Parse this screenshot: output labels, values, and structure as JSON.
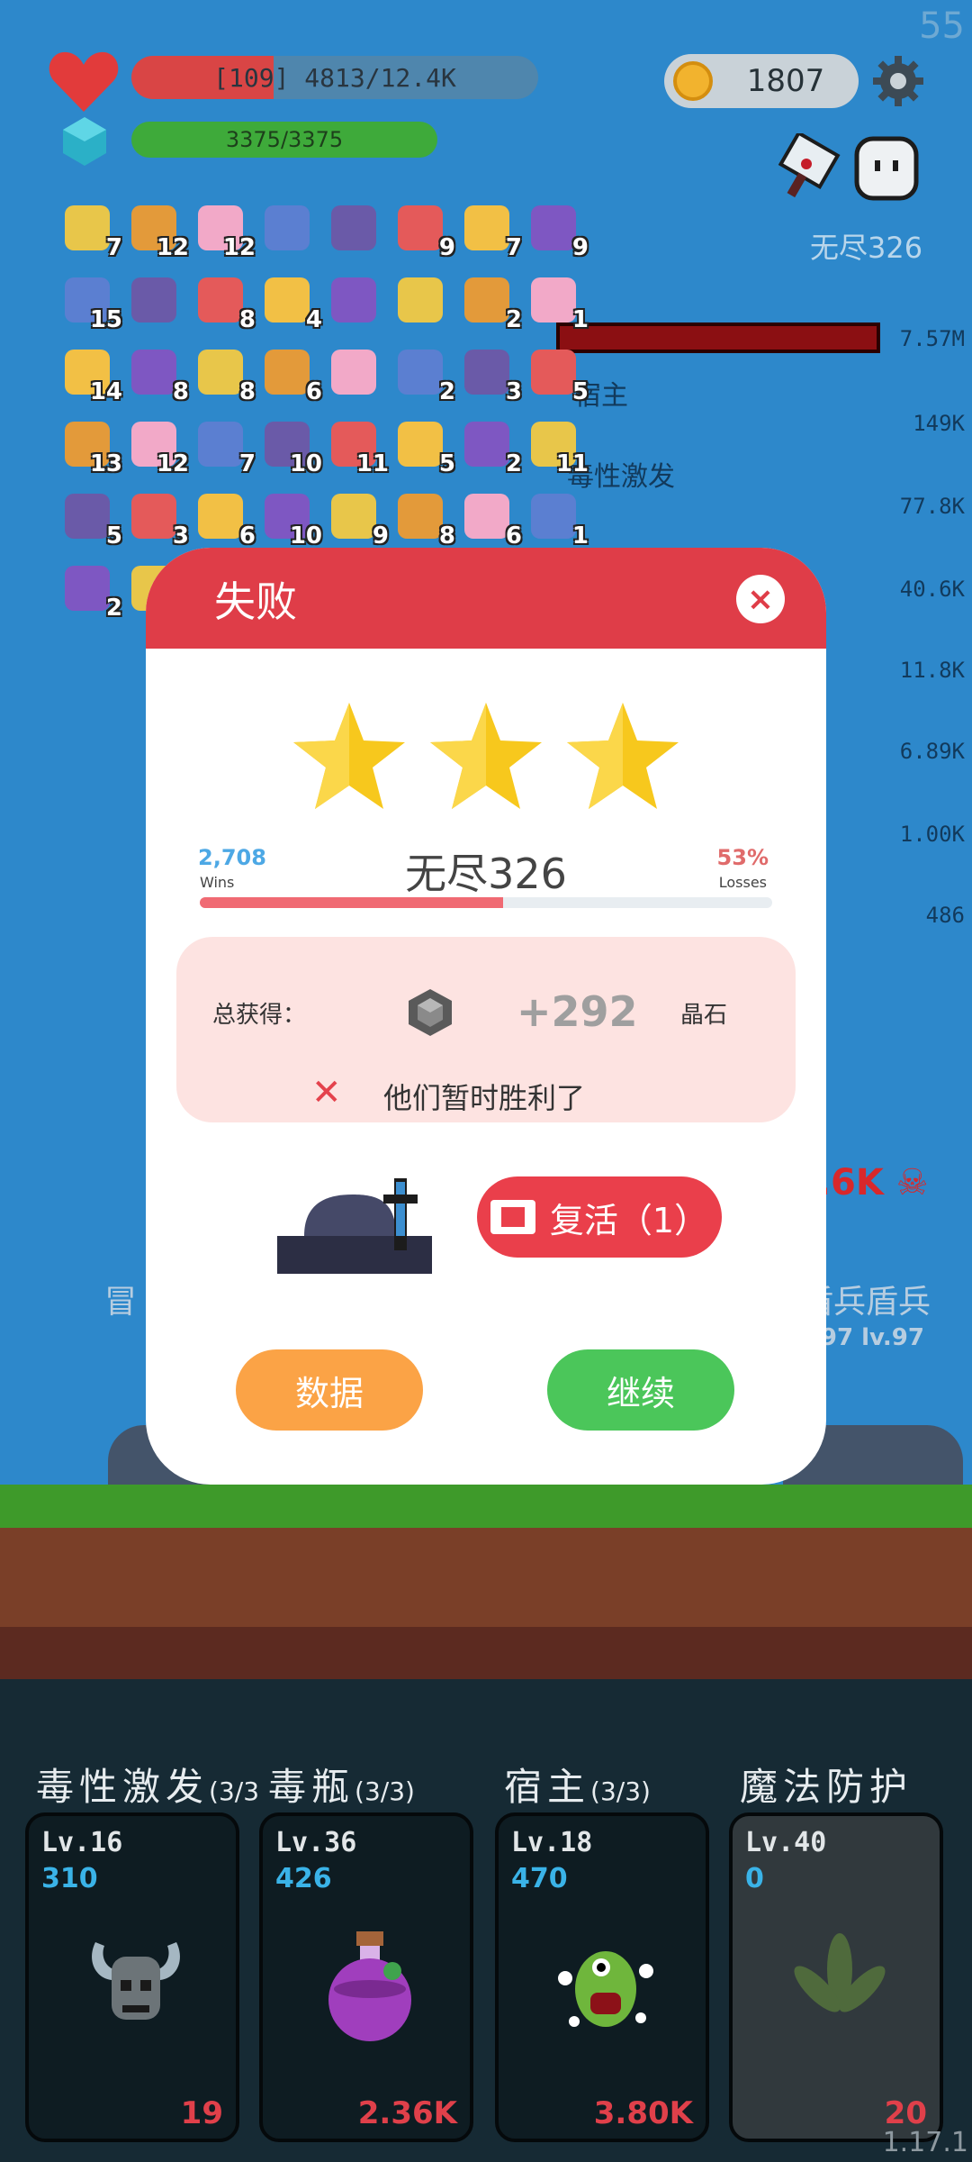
{
  "hud": {
    "fps": "55",
    "hp_text": "[109] 4813/12.4K",
    "mp_text": "3375/3375",
    "coins": "1807",
    "stage_label": "无尽326",
    "right_values": [
      "7.57M",
      "149K",
      "77.8K",
      "40.6K",
      "11.8K",
      "6.89K",
      "1.00K",
      "486"
    ],
    "skill_names_bg": [
      "宿主",
      "毒性激发"
    ],
    "skull_damage": "1.6K",
    "bg_name_left": "冒",
    "bg_name_right": "盾兵盾兵",
    "bg_level_right": ".97 lv.97"
  },
  "inventory": {
    "rows": [
      [
        "7",
        "12",
        "12",
        "",
        "",
        "9",
        "7",
        "9"
      ],
      [
        "15",
        "",
        "8",
        "4",
        "",
        "",
        "2",
        "1"
      ],
      [
        "14",
        "8",
        "8",
        "6",
        "",
        "2",
        "3",
        "5"
      ],
      [
        "13",
        "12",
        "7",
        "10",
        "11",
        "5",
        "2",
        "11"
      ],
      [
        "5",
        "3",
        "6",
        "10",
        "9",
        "8",
        "6",
        "1"
      ],
      [
        "2",
        "",
        "",
        "",
        "",
        "",
        "",
        ""
      ]
    ]
  },
  "modal": {
    "title": "失败",
    "close": "×",
    "stars": 3,
    "wins_num": "2,708",
    "wins_label": "Wins",
    "loss_num": "53%",
    "loss_label": "Losses",
    "level_name": "无尽326",
    "progress": 0.53,
    "reward_label": "总获得：",
    "reward_amount": "+292",
    "reward_unit": "晶石",
    "defeat_msg": "他们暂时胜利了",
    "revive_label": "复活（1）",
    "data_btn": "数据",
    "continue_btn": "继续"
  },
  "skills": [
    {
      "title": "毒性激发",
      "count": "(3/3",
      "level": "Lv.16",
      "points": "310",
      "value": "19"
    },
    {
      "title": "毒瓶",
      "count": "(3/3)",
      "level": "Lv.36",
      "points": "426",
      "value": "2.36K"
    },
    {
      "title": "宿主",
      "count": "(3/3)",
      "level": "Lv.18",
      "points": "470",
      "value": "3.80K"
    },
    {
      "title": "魔法防护",
      "count": "",
      "level": "Lv.40",
      "points": "0",
      "value": "20"
    }
  ],
  "version": "1.17.1"
}
